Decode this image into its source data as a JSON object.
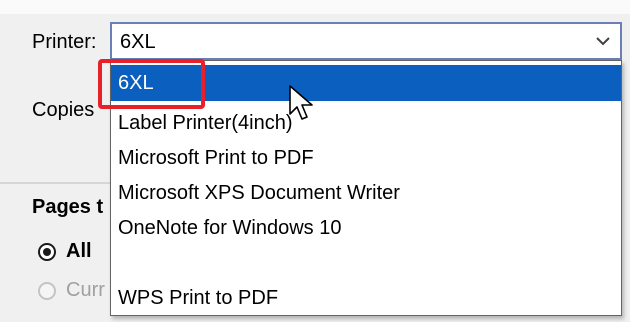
{
  "dialog": {
    "printer_label": "Printer:",
    "copies_label": "Copies",
    "pages_label": "Pages t",
    "radio_all_label": "All",
    "radio_current_label": "Curr"
  },
  "printer_select": {
    "selected_value": "6XL",
    "arrow_icon": "chevron-down-icon"
  },
  "dropdown": {
    "options": [
      {
        "label": "6XL",
        "selected": true
      },
      {
        "label": "Label Printer(4inch)",
        "selected": false
      },
      {
        "label": "Microsoft Print to PDF",
        "selected": false
      },
      {
        "label": "Microsoft XPS Document Writer",
        "selected": false
      },
      {
        "label": "OneNote for Windows 10",
        "selected": false
      },
      {
        "label": "WPS Print to PDF",
        "selected": false
      }
    ]
  },
  "colors": {
    "selection": "#0a5fbf",
    "highlight_annotation": "#e8202a",
    "combo_border": "#6a7fb8"
  }
}
